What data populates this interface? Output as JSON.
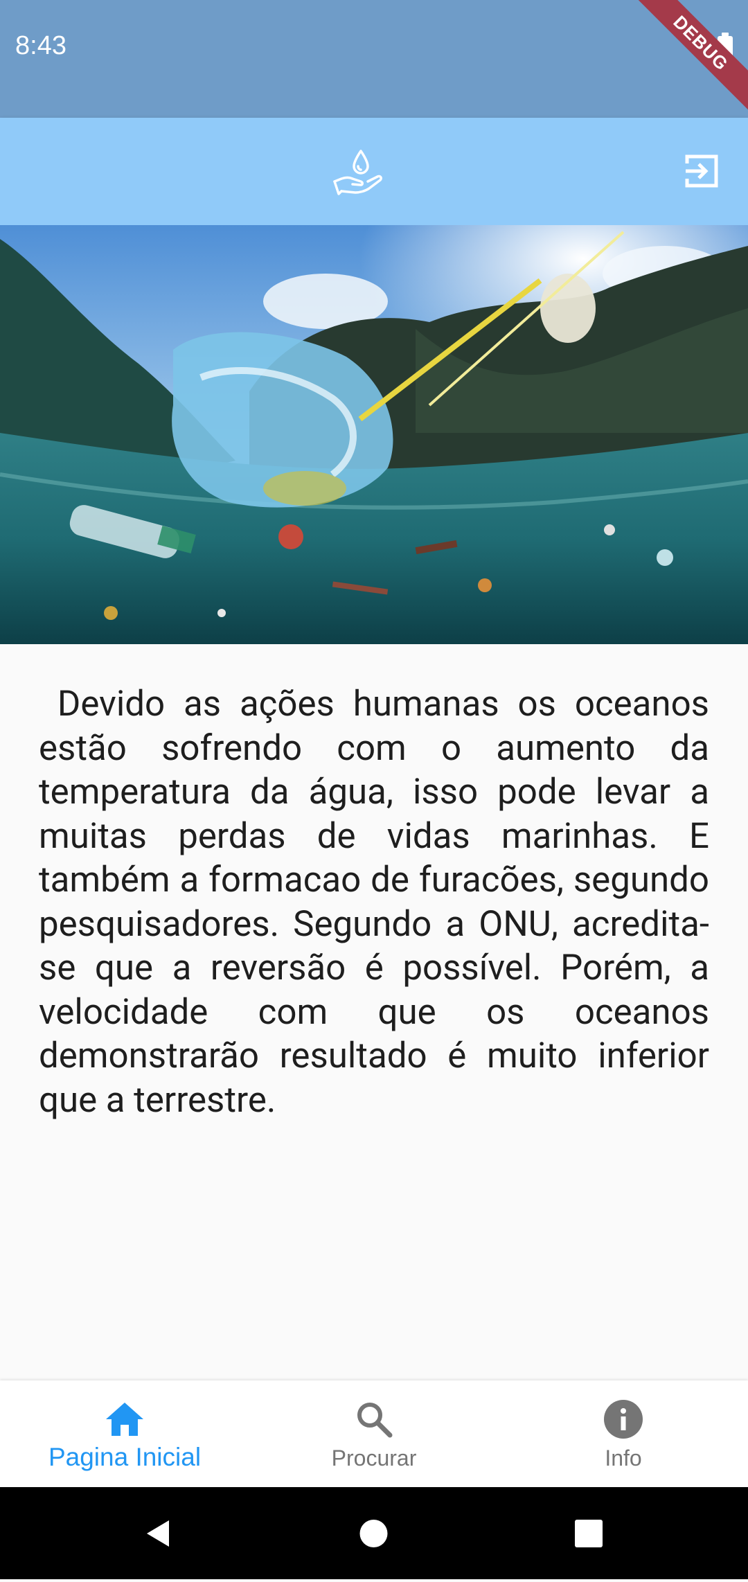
{
  "status_bar": {
    "time": "8:43"
  },
  "debug_banner": "DEBUG",
  "app_bar": {
    "logo_icon": "hand-water-drop-icon",
    "logout_icon": "logout-icon"
  },
  "hero_image": {
    "subject": "underwater-plastic-pollution-photo"
  },
  "content": {
    "paragraph": " Devido as ações humanas os oceanos estão sofrendo com o aumento da temperatura da água, isso pode levar a muitas perdas de vidas marinhas. E também a formacao de furacões, segundo pesquisadores. Segundo a ONU, acredita-se que a reversão é possível. Porém, a velocidade com que os oceanos demonstrarão resultado é muito inferior que a terrestre."
  },
  "bottom_nav": {
    "items": [
      {
        "label": "Pagina Inicial",
        "icon": "home-icon",
        "active": true
      },
      {
        "label": "Procurar",
        "icon": "search-icon",
        "active": false
      },
      {
        "label": "Info",
        "icon": "info-icon",
        "active": false
      }
    ]
  },
  "colors": {
    "status_bar": "#6f9cc8",
    "app_bar": "#90caf9",
    "active_tab": "#2196f3",
    "inactive_tab": "#757575",
    "debug_ribbon": "#a43a4a"
  },
  "system_nav": {
    "back_icon": "back-icon",
    "home_icon": "home-circle-icon",
    "recents_icon": "recents-icon"
  }
}
